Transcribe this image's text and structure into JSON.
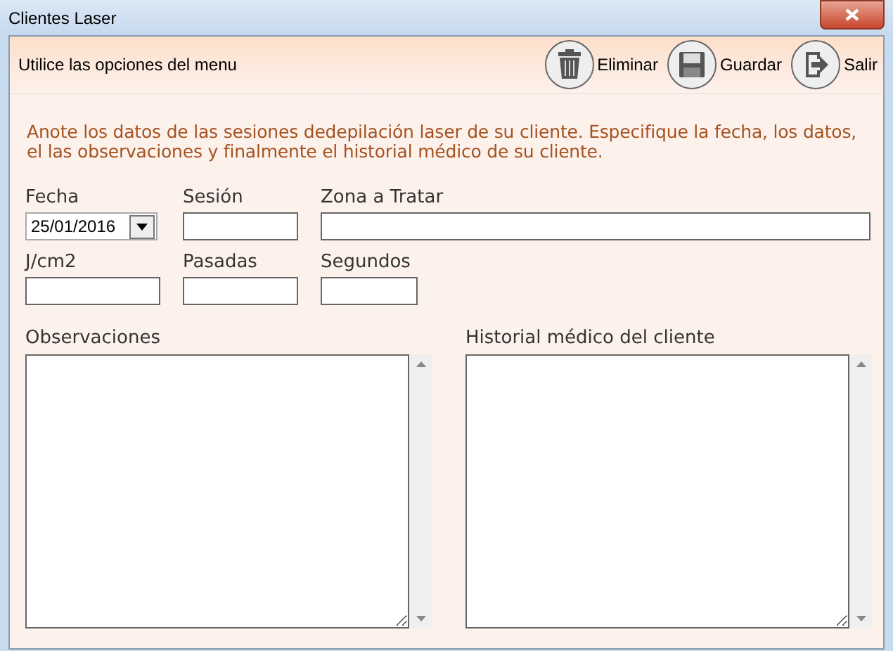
{
  "window": {
    "title": "Clientes Laser"
  },
  "toolbar": {
    "hint": "Utilice las opciones del menu",
    "buttons": [
      {
        "kind": "delete",
        "label": "Eliminar"
      },
      {
        "kind": "save",
        "label": "Guardar"
      },
      {
        "kind": "exit",
        "label": "Salir"
      }
    ]
  },
  "instructions": "Anote los datos de las sesiones dedepilación laser de su cliente. Especifique la fecha, los datos, el las observaciones y finalmente el historial médico de su cliente.",
  "fields": [
    {
      "label": "Fecha",
      "kind": "date",
      "value": "25/01/2016"
    },
    {
      "label": "Sesión",
      "kind": "text"
    },
    {
      "label": "Zona a Tratar",
      "kind": "wide"
    },
    {
      "label": "J/cm2",
      "kind": "text"
    },
    {
      "label": "Pasadas",
      "kind": "text"
    },
    {
      "label": "Segundos",
      "kind": "short"
    }
  ],
  "notes": [
    {
      "label": "Observaciones"
    },
    {
      "label": "Historial médico del cliente"
    }
  ]
}
